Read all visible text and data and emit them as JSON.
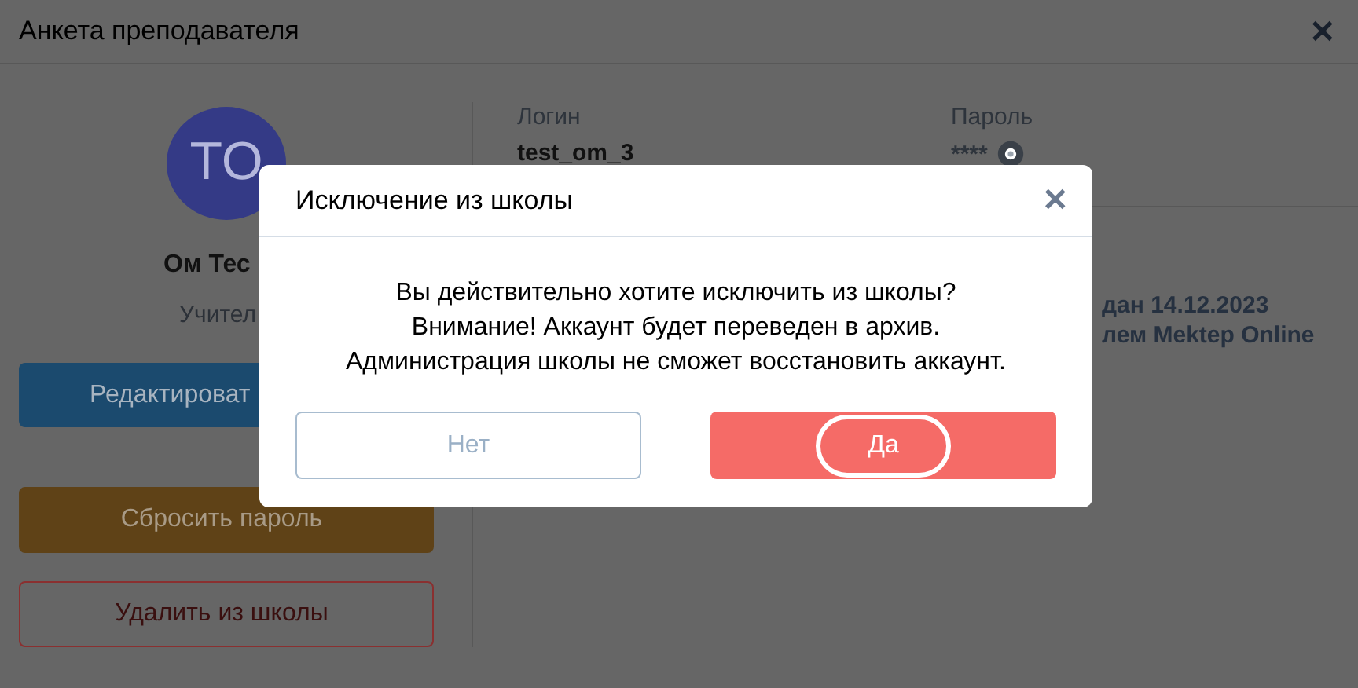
{
  "window": {
    "title": "Анкета преподавателя",
    "close": "✕"
  },
  "profile": {
    "avatar_initials": "TO",
    "name": "Ом Тес",
    "role": "Учител",
    "buttons": [
      {
        "kind": "edit",
        "label": "Редактироват"
      },
      {
        "kind": "reset",
        "label": "Сбросить пароль"
      },
      {
        "kind": "remove",
        "label": "Удалить из школы"
      }
    ]
  },
  "credentials": [
    {
      "label": "Логин",
      "value": "test_om_3",
      "kind": "text"
    },
    {
      "label": "Пароль",
      "value": "****",
      "kind": "secret"
    }
  ],
  "info_lines": [
    "дан 14.12.2023",
    "лем Mektep Online"
  ],
  "dialog": {
    "title": "Исключение из школы",
    "close": "✕",
    "message": [
      "Вы действительно хотите исключить из школы?",
      "Внимание! Аккаунт будет переведен в архив.",
      "Администрация школы не сможет восстановить аккаунт."
    ],
    "buttons": [
      {
        "kind": "cancel",
        "label": "Нет",
        "focused": false
      },
      {
        "kind": "confirm",
        "label": "Да",
        "focused": true
      }
    ]
  }
}
